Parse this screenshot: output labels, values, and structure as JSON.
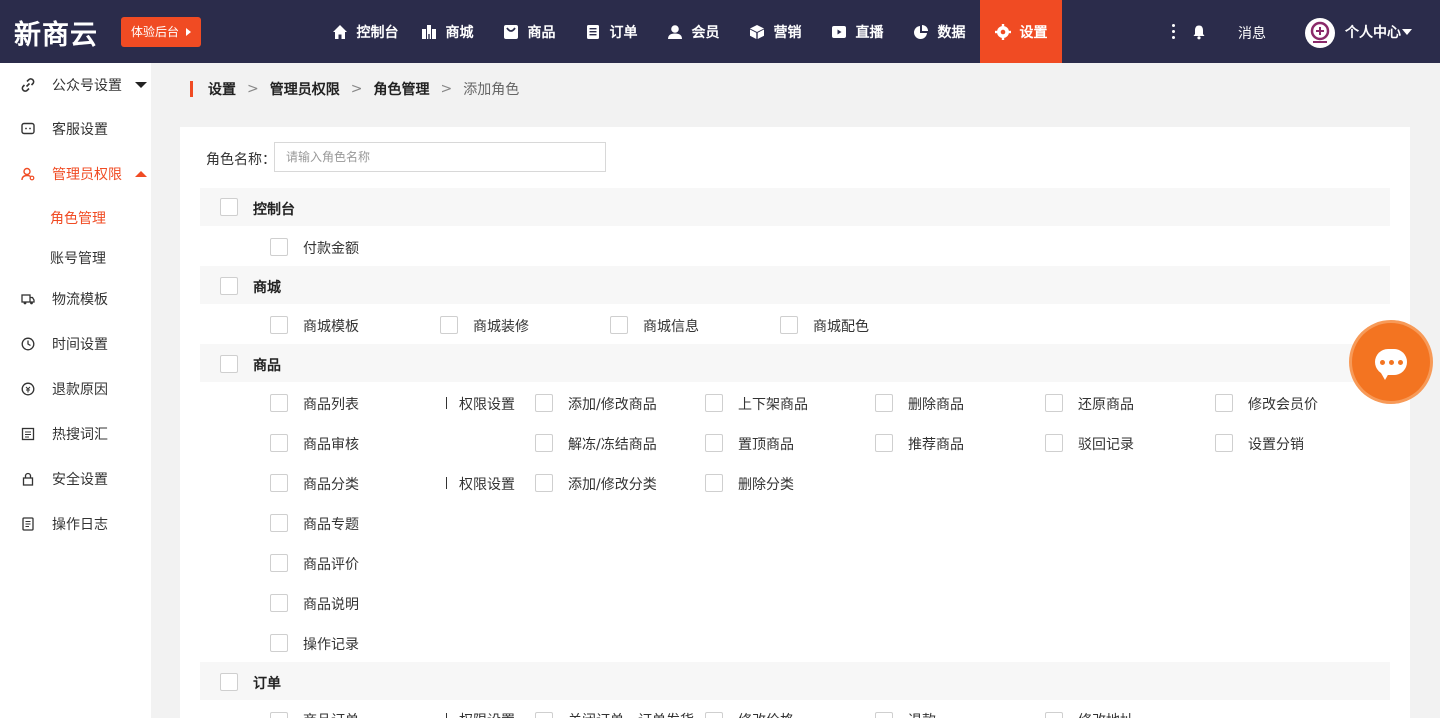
{
  "brand": {
    "logo_text": "新商云",
    "trial_button": "体验后台",
    "accent_color": "#f04b23",
    "topbar_color": "#2b2c4b"
  },
  "nav": {
    "items": [
      {
        "label": "控制台",
        "icon": "home-icon"
      },
      {
        "label": "商城",
        "icon": "store-icon"
      },
      {
        "label": "商品",
        "icon": "product-icon"
      },
      {
        "label": "订单",
        "icon": "order-icon"
      },
      {
        "label": "会员",
        "icon": "member-icon"
      },
      {
        "label": "营销",
        "icon": "marketing-icon"
      },
      {
        "label": "直播",
        "icon": "live-icon"
      },
      {
        "label": "数据",
        "icon": "data-icon"
      },
      {
        "label": "设置",
        "icon": "settings-icon",
        "active": true
      }
    ],
    "messages_label": "消息",
    "user_center_label": "个人中心"
  },
  "sidebar": {
    "items": [
      {
        "label": "公众号设置",
        "icon": "link-icon"
      },
      {
        "label": "客服设置",
        "icon": "chat-icon"
      },
      {
        "label": "管理员权限",
        "icon": "admin-icon",
        "active": true
      },
      {
        "label": "物流模板",
        "icon": "truck-icon"
      },
      {
        "label": "时间设置",
        "icon": "clock-icon"
      },
      {
        "label": "退款原因",
        "icon": "refund-icon"
      },
      {
        "label": "热搜词汇",
        "icon": "list-icon"
      },
      {
        "label": "安全设置",
        "icon": "lock-icon"
      },
      {
        "label": "操作日志",
        "icon": "log-icon"
      }
    ],
    "sub_items": [
      {
        "label": "角色管理",
        "active": true
      },
      {
        "label": "账号管理"
      }
    ]
  },
  "breadcrumb": [
    "设置",
    "管理员权限",
    "角色管理",
    "添加角色"
  ],
  "form": {
    "role_name_label": "角色名称：",
    "role_name_placeholder": "请输入角色名称",
    "role_name_value": ""
  },
  "permissions": {
    "dashboard": {
      "label": "控制台",
      "items": [
        "付款金额"
      ]
    },
    "mall": {
      "label": "商城",
      "items": [
        "商城模板",
        "商城装修",
        "商城信息",
        "商城配色"
      ]
    },
    "product": {
      "label": "商品",
      "rows": [
        {
          "name": "商品列表",
          "perm_label": "权限设置",
          "perms": [
            "添加/修改商品",
            "上下架商品",
            "删除商品",
            "还原商品",
            "修改会员价"
          ]
        },
        {
          "name": "商品审核",
          "perms": [
            "解冻/冻结商品",
            "置顶商品",
            "推荐商品",
            "驳回记录",
            "设置分销"
          ]
        },
        {
          "name": "商品分类",
          "perm_label": "权限设置",
          "perms": [
            "添加/修改分类",
            "删除分类"
          ]
        },
        {
          "name": "商品专题",
          "perms": []
        },
        {
          "name": "商品评价",
          "perms": []
        },
        {
          "name": "商品说明",
          "perms": []
        },
        {
          "name": "操作记录",
          "perms": []
        }
      ]
    },
    "order": {
      "label": "订单",
      "rows": [
        {
          "name": "商品订单",
          "perm_label": "权限设置",
          "perms": [
            "关闭订单",
            "订单发货",
            "修改价格",
            "退款",
            "修改地址"
          ]
        }
      ]
    }
  }
}
